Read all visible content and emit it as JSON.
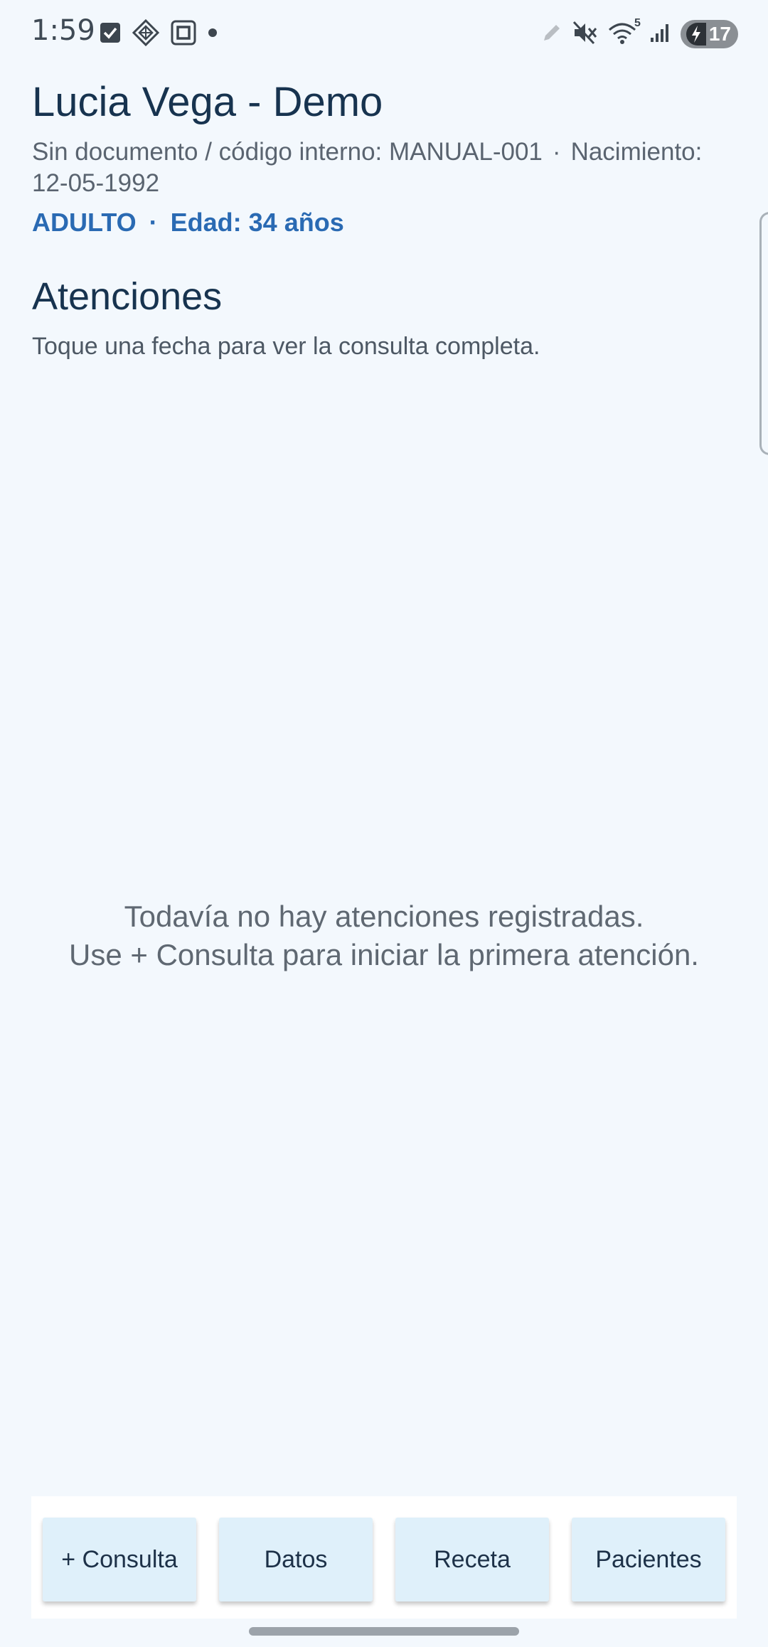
{
  "status_bar": {
    "time": "1:59",
    "left_icons": [
      "checkbox-notification-icon",
      "diamond-grid-notification-icon",
      "square-notification-icon",
      "dot-notification-icon"
    ],
    "right_icons": [
      "pencil-icon",
      "mute-icon",
      "wifi-icon",
      "cellular-signal-icon"
    ],
    "wifi_badge": "5",
    "battery_level": "17"
  },
  "patient": {
    "name": "Lucia Vega - Demo",
    "document": "Sin documento / código interno: MANUAL-001",
    "separator": "·",
    "birth": "Nacimiento: 12-05-1992",
    "category": "ADULTO",
    "age": "Edad: 34 años"
  },
  "attentions": {
    "title": "Atenciones",
    "hint": "Toque una fecha para ver la consulta completa.",
    "empty_line1": "Todavía no hay atenciones registradas.",
    "empty_line2": "Use + Consulta para iniciar la primera atención."
  },
  "bottom_bar": {
    "consulta": "+ Consulta",
    "datos": "Datos",
    "receta": "Receta",
    "pacientes": "Pacientes"
  },
  "colors": {
    "background": "#f3f8fd",
    "title": "#17334f",
    "accent": "#2a6ab3",
    "button_bg": "#dff0fa"
  }
}
